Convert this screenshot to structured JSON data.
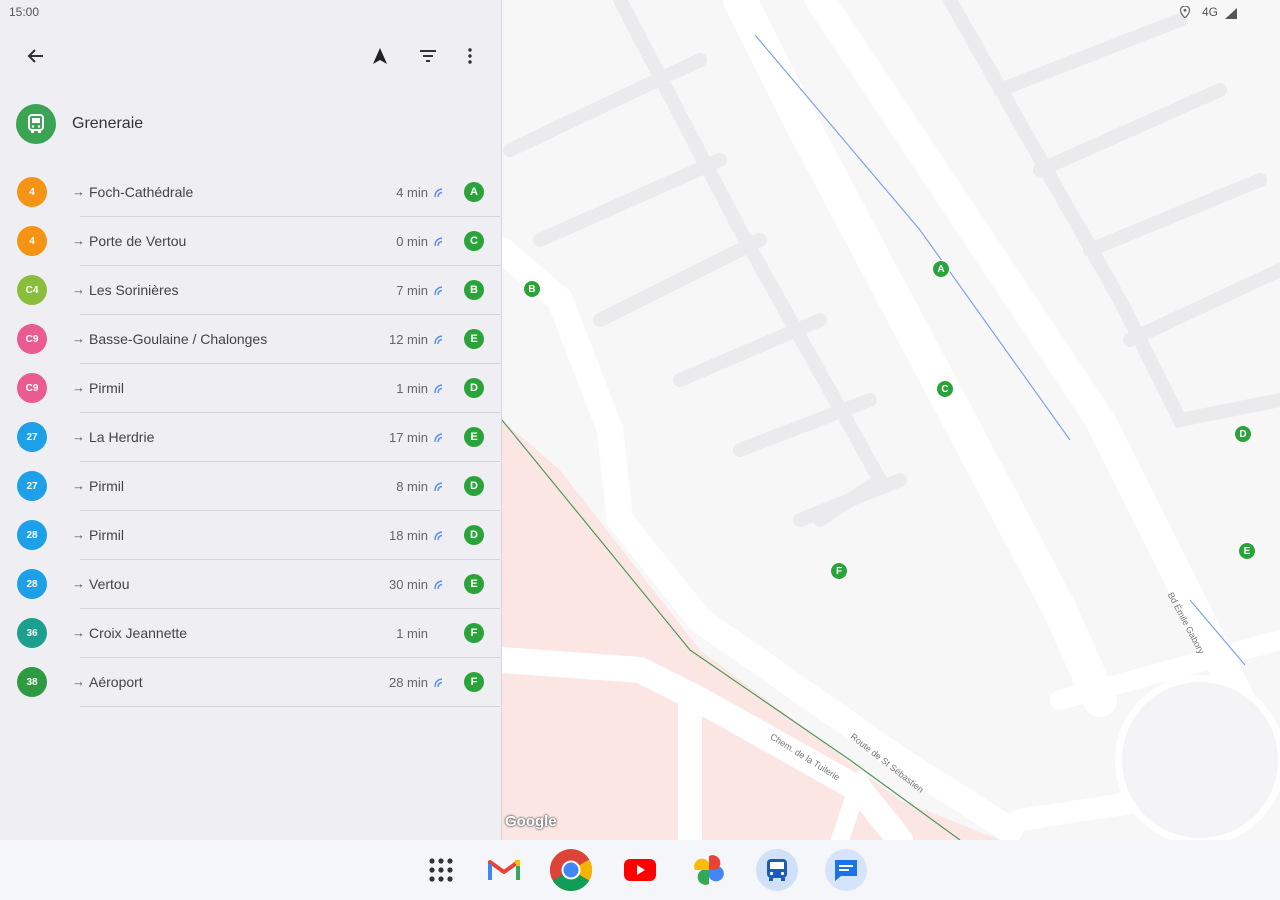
{
  "status_bar": {
    "time": "15:00",
    "network": "4G"
  },
  "toolbar": {
    "icons": [
      "back-arrow-icon",
      "navigation-icon",
      "filter-icon",
      "more-vert-icon"
    ]
  },
  "stop": {
    "name": "Greneraie",
    "icon": "bus-icon",
    "color": "#3aa453"
  },
  "departures": [
    {
      "line": "4",
      "line_color": "#f59314",
      "arrow": "→",
      "destination": "Foch-Cathédrale",
      "time": "4 min",
      "realtime": true,
      "platform": "A"
    },
    {
      "line": "4",
      "line_color": "#f59314",
      "arrow": "→",
      "destination": "Porte de Vertou",
      "time": "0 min",
      "realtime": true,
      "platform": "C"
    },
    {
      "line": "C4",
      "line_color": "#8bbd3c",
      "arrow": "→",
      "destination": "Les Sorinières",
      "time": "7 min",
      "realtime": true,
      "platform": "B"
    },
    {
      "line": "C9",
      "line_color": "#ea5b92",
      "arrow": "→",
      "destination": "Basse-Goulaine / Chalonges",
      "time": "12 min",
      "realtime": true,
      "platform": "E"
    },
    {
      "line": "C9",
      "line_color": "#ea5b92",
      "arrow": "→",
      "destination": "Pirmil",
      "time": "1 min",
      "realtime": true,
      "platform": "D"
    },
    {
      "line": "27",
      "line_color": "#1ea0e8",
      "arrow": "→",
      "destination": "La Herdrie",
      "time": "17 min",
      "realtime": true,
      "platform": "E"
    },
    {
      "line": "27",
      "line_color": "#1ea0e8",
      "arrow": "→",
      "destination": "Pirmil",
      "time": "8 min",
      "realtime": true,
      "platform": "D"
    },
    {
      "line": "28",
      "line_color": "#1ea0e8",
      "arrow": "→",
      "destination": "Pirmil",
      "time": "18 min",
      "realtime": true,
      "platform": "D"
    },
    {
      "line": "28",
      "line_color": "#1ea0e8",
      "arrow": "→",
      "destination": "Vertou",
      "time": "30 min",
      "realtime": true,
      "platform": "E"
    },
    {
      "line": "36",
      "line_color": "#1aa08c",
      "arrow": "→",
      "destination": "Croix Jeannette",
      "time": "1 min",
      "realtime": false,
      "platform": "F"
    },
    {
      "line": "38",
      "line_color": "#2e9a42",
      "arrow": "→",
      "destination": "Aéroport",
      "time": "28 min",
      "realtime": true,
      "platform": "F"
    }
  ],
  "map": {
    "markers": [
      "A",
      "B",
      "C",
      "D",
      "E",
      "F"
    ],
    "attribution": "Google",
    "streets": [
      "Route de St Sébastien",
      "Chem. de la Tuilerie",
      "Bd Émile Gabory"
    ]
  },
  "taskbar": {
    "apps": [
      "app-drawer-icon",
      "gmail-icon",
      "chrome-icon",
      "youtube-icon",
      "photos-icon",
      "transit-app-icon",
      "messages-icon"
    ]
  }
}
